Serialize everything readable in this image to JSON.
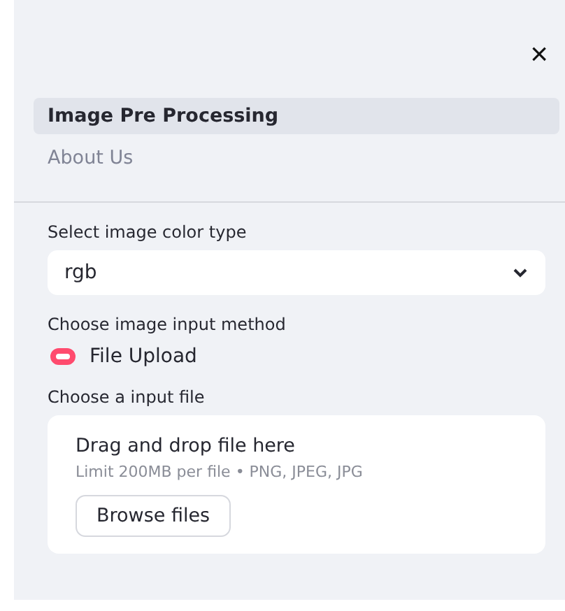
{
  "close_button": {
    "label": "×"
  },
  "nav": [
    {
      "label": "Image Pre Processing",
      "selected": true
    },
    {
      "label": "About Us",
      "selected": false
    }
  ],
  "color_select": {
    "label": "Select image color type",
    "value": "rgb"
  },
  "input_method": {
    "label": "Choose image input method",
    "options": [
      {
        "label": "File Upload",
        "selected": true
      }
    ]
  },
  "uploader": {
    "label": "Choose a input file",
    "title": "Drag and drop file here",
    "hint": "Limit 200MB per file • PNG, JPEG, JPG",
    "button": "Browse files"
  }
}
